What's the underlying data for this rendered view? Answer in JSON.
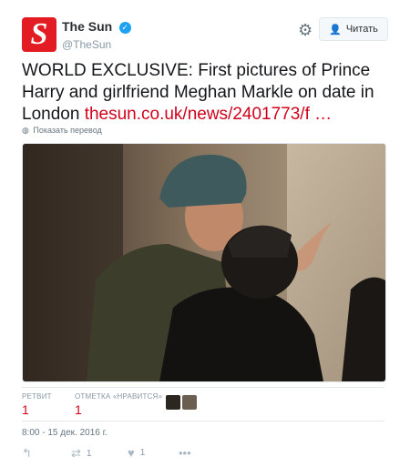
{
  "account": {
    "logo_letter": "S",
    "display_name": "The Sun",
    "handle": "@TheSun",
    "follow_label": "Читать"
  },
  "tweet": {
    "text": "WORLD EXCLUSIVE: First pictures of Prince Harry and girlfriend Meghan Markle on date in London",
    "link": "thesun.co.uk/news/2401773/f …",
    "translate_label": "Показать перевод"
  },
  "stats": {
    "retweets_label": "РЕТВИТ",
    "retweets_value": "1",
    "likes_label": "ОТМЕТКА «НРАВИТСЯ»",
    "likes_value": "1"
  },
  "timestamp": "8:00 - 15 дек. 2016 г.",
  "actions": {
    "retweet_count": "1",
    "like_count": "1"
  },
  "colors": {
    "brand_red": "#e31b23",
    "link_red": "#d0021b",
    "verified_blue": "#1da1f2"
  }
}
